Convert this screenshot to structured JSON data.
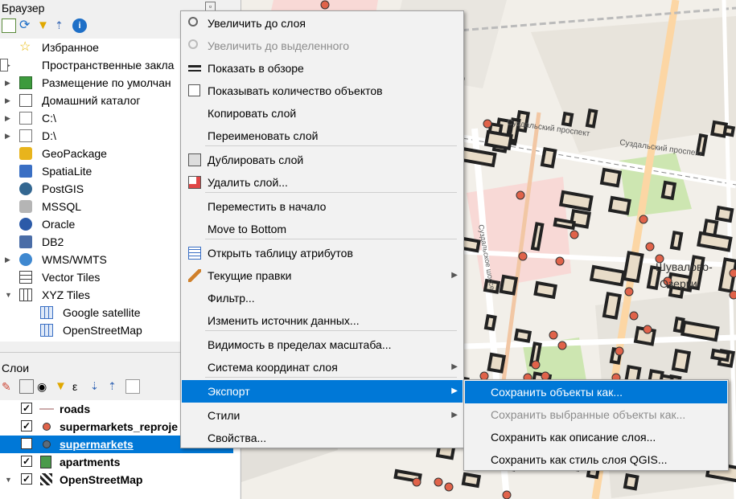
{
  "browser": {
    "title": "Браузер",
    "items": [
      {
        "label": "Избранное",
        "icon": "star-icon",
        "arrow": ""
      },
      {
        "label": "Пространственные закла",
        "icon": "bookmark-icon",
        "arrow": "▶"
      },
      {
        "label": "Размещение по умолчан",
        "icon": "project-home-icon",
        "arrow": "▶"
      },
      {
        "label": "Домашний каталог",
        "icon": "home-folder-icon",
        "arrow": "▶"
      },
      {
        "label": "C:\\",
        "icon": "folder-icon",
        "arrow": "▶"
      },
      {
        "label": "D:\\",
        "icon": "folder-icon",
        "arrow": "▶"
      },
      {
        "label": "GeoPackage",
        "icon": "geopackage-icon",
        "arrow": ""
      },
      {
        "label": "SpatiaLite",
        "icon": "spatialite-icon",
        "arrow": ""
      },
      {
        "label": "PostGIS",
        "icon": "postgis-icon",
        "arrow": ""
      },
      {
        "label": "MSSQL",
        "icon": "mssql-icon",
        "arrow": ""
      },
      {
        "label": "Oracle",
        "icon": "oracle-icon",
        "arrow": ""
      },
      {
        "label": "DB2",
        "icon": "db2-icon",
        "arrow": ""
      },
      {
        "label": "WMS/WMTS",
        "icon": "globe-icon",
        "arrow": "▶"
      },
      {
        "label": "Vector Tiles",
        "icon": "vector-tiles-icon",
        "arrow": ""
      },
      {
        "label": "XYZ Tiles",
        "icon": "xyz-tiles-icon",
        "arrow": "▼"
      },
      {
        "label": "Google satellite",
        "icon": "tile-grid-icon",
        "arrow": "",
        "child": true
      },
      {
        "label": "OpenStreetMap",
        "icon": "tile-grid-icon",
        "arrow": "",
        "child": true
      }
    ]
  },
  "layers": {
    "title": "Слои",
    "items": [
      {
        "label": "roads",
        "symbol": "line",
        "checked": "✓"
      },
      {
        "label": "supermarkets_reproje",
        "symbol": "dot",
        "checked": "✓"
      },
      {
        "label": "supermarkets",
        "symbol": "dot",
        "checked": "✓",
        "selected": true
      },
      {
        "label": "apartments",
        "symbol": "poly",
        "checked": "✓"
      },
      {
        "label": "OpenStreetMap",
        "symbol": "raster",
        "checked": "✓"
      }
    ]
  },
  "context_menu": {
    "items": [
      {
        "label": "Увеличить до слоя",
        "icon": "zoom-layer-icon",
        "disabled": false
      },
      {
        "label": "Увеличить до выделенного",
        "icon": "zoom-selection-icon",
        "disabled": true
      },
      {
        "label": "Показать в обзоре",
        "icon": "overview-glasses-icon",
        "disabled": false
      },
      {
        "label": "Показывать количество объектов",
        "icon": "checkbox-icon",
        "disabled": false
      },
      {
        "label": "Копировать слой",
        "icon": "",
        "disabled": false
      },
      {
        "label": "Переименовать слой",
        "icon": "",
        "disabled": false
      },
      {
        "label": "Дублировать слой",
        "icon": "duplicate-layer-icon",
        "disabled": false
      },
      {
        "label": "Удалить слой...",
        "icon": "remove-layer-icon",
        "disabled": false
      },
      {
        "label": "Переместить в начало",
        "icon": "",
        "disabled": false
      },
      {
        "label": "Move to Bottom",
        "icon": "",
        "disabled": false
      },
      {
        "label": "Открыть таблицу атрибутов",
        "icon": "attribute-table-icon",
        "disabled": false
      },
      {
        "label": "Текущие правки",
        "icon": "pencil-icon",
        "disabled": false,
        "submenu": true
      },
      {
        "label": "Фильтр...",
        "icon": "",
        "disabled": false
      },
      {
        "label": "Изменить источник данных...",
        "icon": "",
        "disabled": false
      },
      {
        "label": "Видимость в пределах масштаба...",
        "icon": "",
        "disabled": false
      },
      {
        "label": "Система координат слоя",
        "icon": "",
        "disabled": false,
        "submenu": true
      },
      {
        "label": "Экспорт",
        "icon": "",
        "disabled": false,
        "submenu": true,
        "highlighted": true
      },
      {
        "label": "Стили",
        "icon": "",
        "disabled": false,
        "submenu": true
      },
      {
        "label": "Свойства...",
        "icon": "",
        "disabled": false
      }
    ]
  },
  "export_submenu": {
    "items": [
      {
        "label": "Сохранить объекты как...",
        "disabled": false,
        "highlighted": true
      },
      {
        "label": "Сохранить выбранные объекты как...",
        "disabled": true
      },
      {
        "label": "Сохранить как описание слоя...",
        "disabled": false
      },
      {
        "label": "Сохранить как стиль слоя QGIS...",
        "disabled": false
      }
    ]
  },
  "map": {
    "labels": [
      "Суздальский проспект",
      "Суздальский проспект",
      "Суздальское шоссе",
      "Озерки",
      "Шувалово-"
    ]
  },
  "colors": {
    "accent": "#0078d7",
    "poi": "#e0634a",
    "road_outline": "#222222",
    "park": "#cde6b1"
  }
}
